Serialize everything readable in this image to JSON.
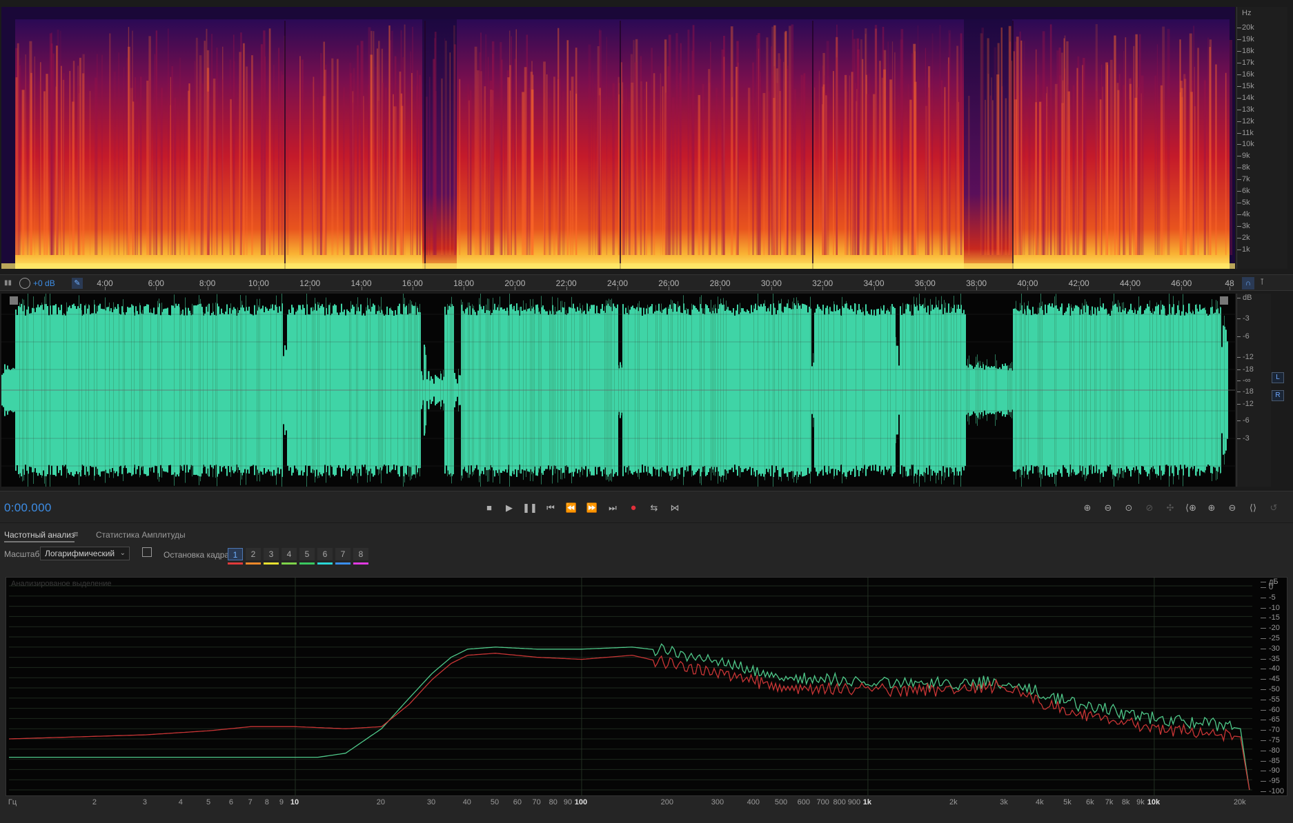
{
  "spectrogram": {
    "hz_unit": "Hz",
    "hz_labels": [
      "20k",
      "19k",
      "18k",
      "17k",
      "16k",
      "15k",
      "14k",
      "13k",
      "12k",
      "11k",
      "10k",
      "9k",
      "8k",
      "7k",
      "6k",
      "5k",
      "4k",
      "3k",
      "2k",
      "1k"
    ]
  },
  "time_ruler": {
    "level_label": "+0 dB",
    "labels": [
      "4:00",
      "6:00",
      "8:00",
      "10:00",
      "12:00",
      "14:00",
      "16:00",
      "18:00",
      "20:00",
      "22:00",
      "24:00",
      "26:00",
      "28:00",
      "30:00",
      "32:00",
      "34:00",
      "36:00",
      "38:00",
      "40:00",
      "42:00",
      "44:00",
      "46:00",
      "48"
    ]
  },
  "waveform": {
    "db_labels": [
      "dB",
      "-3",
      "-6",
      "-12",
      "-18",
      "-∞",
      "-18",
      "-12",
      "-6",
      "-3"
    ],
    "channels": [
      "L",
      "R"
    ]
  },
  "transport": {
    "timecode": "0:00.000",
    "buttons": [
      "stop",
      "play",
      "pause",
      "to-start",
      "rewind",
      "fast-forward",
      "to-end",
      "record",
      "loop",
      "skip"
    ],
    "zoom_buttons": [
      "zoom-in-amplitude",
      "zoom-out-amplitude",
      "zoom-reset-amplitude",
      "zoom-disabled",
      "zoom-full",
      "zoom-in-left",
      "zoom-in-time",
      "zoom-out-time",
      "zoom-to-selection",
      "zoom-history",
      "zoom-fit"
    ]
  },
  "panel": {
    "tabs": [
      "Частотный анализ",
      "Статистика Амплитуды"
    ],
    "scale_label": "Масштаб:",
    "scale_value": "Логарифмический",
    "frame_hold_label": "Остановка кадра:",
    "frames": [
      {
        "num": "1",
        "color": "#e03a3a"
      },
      {
        "num": "2",
        "color": "#f0882a"
      },
      {
        "num": "3",
        "color": "#e8e030"
      },
      {
        "num": "4",
        "color": "#7ed34a"
      },
      {
        "num": "5",
        "color": "#3ac860"
      },
      {
        "num": "6",
        "color": "#2ad6d6"
      },
      {
        "num": "7",
        "color": "#3a8ef0"
      },
      {
        "num": "8",
        "color": "#e03ae0"
      }
    ],
    "analyzed_label": "Анализированое выделение"
  },
  "chart_data": {
    "type": "line",
    "xscale": "log",
    "xlim": [
      1,
      22000
    ],
    "ylim": [
      -100,
      0
    ],
    "xlabel": "Гц",
    "ylabel": "дБ",
    "x_ticks": [
      "Гц",
      "2",
      "3",
      "4",
      "5",
      "6",
      "7",
      "8",
      "9",
      "10",
      "20",
      "30",
      "40",
      "50",
      "60",
      "70",
      "80",
      "90",
      "100",
      "200",
      "300",
      "400",
      "500",
      "600",
      "700",
      "800",
      "900",
      "1k",
      "2k",
      "3k",
      "4k",
      "5k",
      "6k",
      "7k",
      "8k",
      "9k",
      "10k",
      "20k"
    ],
    "y_ticks": [
      "дБ",
      "0",
      "-5",
      "-10",
      "-15",
      "-20",
      "-25",
      "-30",
      "-35",
      "-40",
      "-45",
      "-50",
      "-55",
      "-60",
      "-65",
      "-70",
      "-75",
      "-80",
      "-85",
      "-90",
      "-95",
      "-100"
    ],
    "series": [
      {
        "color": "#4fc98a",
        "x": [
          1,
          5,
          10,
          12,
          15,
          20,
          25,
          30,
          35,
          40,
          50,
          70,
          100,
          150,
          200,
          250,
          300,
          500,
          1000,
          2000,
          3000,
          5000,
          10000,
          15000,
          20000,
          21500
        ],
        "y": [
          -84,
          -84,
          -84,
          -84,
          -82,
          -70,
          -55,
          -43,
          -35,
          -31,
          -30,
          -31,
          -31,
          -30,
          -32,
          -35,
          -37,
          -45,
          -47,
          -48,
          -47,
          -57,
          -65,
          -67,
          -70,
          -100
        ]
      },
      {
        "color": "#c93535",
        "x": [
          1,
          3,
          5,
          7,
          10,
          15,
          20,
          25,
          30,
          35,
          40,
          50,
          70,
          100,
          150,
          200,
          250,
          300,
          500,
          1000,
          2000,
          3000,
          5000,
          10000,
          15000,
          20000,
          21500
        ],
        "y": [
          -75,
          -73,
          -71,
          -69,
          -69,
          -70,
          -69,
          -58,
          -46,
          -38,
          -34,
          -33,
          -35,
          -36,
          -34,
          -38,
          -41,
          -42,
          -50,
          -51,
          -51,
          -49,
          -62,
          -70,
          -72,
          -74,
          -100
        ]
      }
    ]
  },
  "theme": {
    "wave_color": "#3fd4a6",
    "accent": "#3d8de5",
    "record": "#e0303a"
  }
}
